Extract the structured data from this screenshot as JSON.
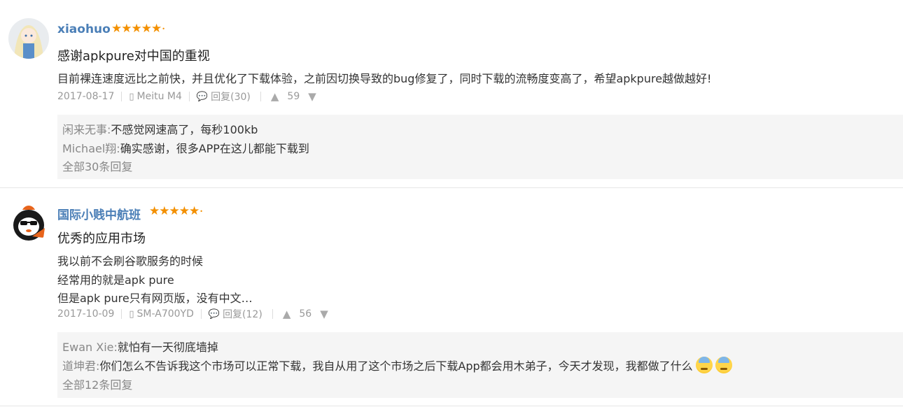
{
  "reviews": [
    {
      "user": "xiaohuo",
      "stars": "★★★★★",
      "title": "感谢apkpure对中国的重视",
      "body": [
        "目前裸连速度远比之前快，并且优化了下载体验，之前因切换导致的bug修复了，同时下载的流畅度变高了，希望apkpure越做越好!"
      ],
      "date": "2017-08-17",
      "device": "Meitu M4",
      "reply_count": "回复(30)",
      "likes": "59",
      "replies": [
        {
          "user": "闲来无事:",
          "text": "不感觉网速高了，每秒100kb"
        },
        {
          "user": "Michael翔:",
          "text": "确实感谢，很多APP在这儿都能下载到"
        }
      ],
      "all_replies": "全部30条回复"
    },
    {
      "user": "国际小贱中航班",
      "stars": "★★★★★",
      "title": "优秀的应用市场",
      "body": [
        "我以前不会刷谷歌服务的时候",
        "经常用的就是apk pure",
        "但是apk pure只有网页版，没有中文…"
      ],
      "date": "2017-10-09",
      "device": "SM-A700YD",
      "reply_count": "回复(12)",
      "likes": "56",
      "replies": [
        {
          "user": "Ewan Xie:",
          "text": "就怕有一天彻底墙掉"
        },
        {
          "user": "道坤君:",
          "text": "你们怎么不告诉我这个市场可以正常下载，我自从用了这个市场之后下载App都会用木弟子，今天才发现，我都做了什么"
        }
      ],
      "all_replies": "全部12条回复"
    }
  ],
  "icons": {
    "phone": "phone-icon",
    "comment": "comment-icon",
    "upvote": "thumbs-up-icon",
    "downvote": "thumbs-down-icon"
  },
  "colors": {
    "username": "#4b7fb7",
    "stars": "#f39000",
    "reply_bg": "#f5f5f5"
  }
}
